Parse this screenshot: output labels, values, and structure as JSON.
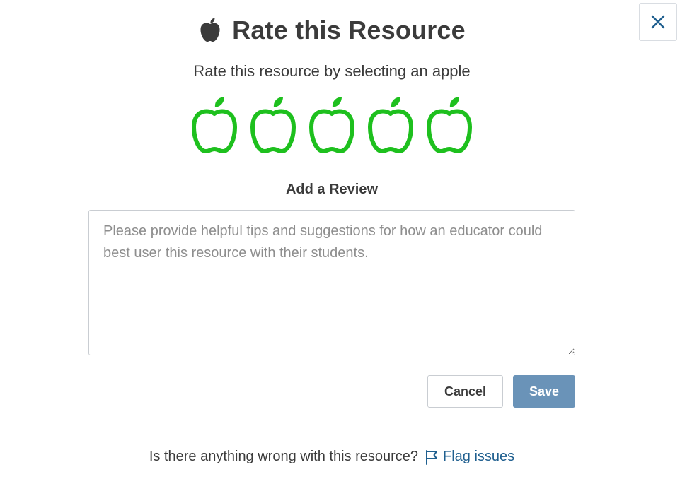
{
  "dialog": {
    "title": "Rate this Resource",
    "subtitle": "Rate this resource by selecting an apple",
    "title_icon": "apple-icon",
    "close_icon": "close-icon"
  },
  "rating": {
    "max": 5,
    "selected": 0,
    "icon": "apple-outline-icon",
    "color": "#1ec01e"
  },
  "review": {
    "label": "Add a Review",
    "value": "",
    "placeholder": "Please provide helpful tips and suggestions for how an educator could best user this resource with their students."
  },
  "actions": {
    "cancel_label": "Cancel",
    "save_label": "Save",
    "save_color": "#6a93b8"
  },
  "footer": {
    "question": "Is there anything wrong with this resource?",
    "flag_label": "Flag issues",
    "flag_icon": "flag-icon",
    "link_color": "#1f5f8f"
  }
}
